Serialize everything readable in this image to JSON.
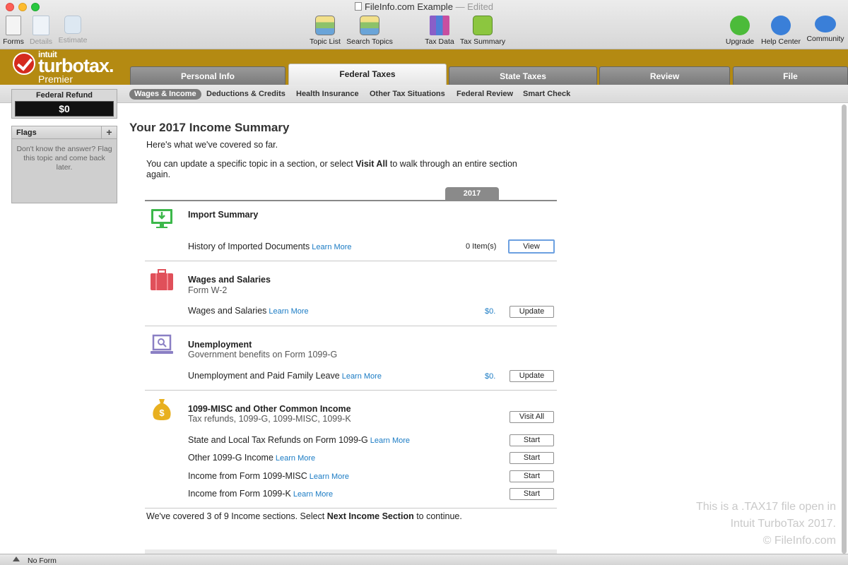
{
  "window": {
    "title": "FileInfo.com Example",
    "edited": "— Edited"
  },
  "toolbar": {
    "left": [
      "Forms",
      "Details",
      "Estimate"
    ],
    "center": [
      "Topic List",
      "Search Topics",
      "Tax Data",
      "Tax Summary"
    ],
    "right": [
      "Upgrade",
      "Help Center",
      "Community"
    ]
  },
  "logo": {
    "intuit": "intuit",
    "brand": "turbotax.",
    "edition": "Premier"
  },
  "tabs": [
    "Personal Info",
    "Federal Taxes",
    "State Taxes",
    "Review",
    "File"
  ],
  "subnav": [
    "Wages & Income",
    "Deductions & Credits",
    "Health Insurance",
    "Other Tax Situations",
    "Federal Review",
    "Smart Check"
  ],
  "refund": {
    "label": "Federal Refund",
    "value": "$0"
  },
  "flags": {
    "title": "Flags",
    "plus": "+",
    "body": "Don't know the answer? Flag this topic and come back later."
  },
  "main": {
    "title": "Your 2017 Income Summary",
    "intro1": "Here's what we've covered so far.",
    "intro2_pre": "You can update a specific topic in a section, or select ",
    "intro2_bold": "Visit All",
    "intro2_post": " to walk through an entire section again.",
    "year": "2017",
    "learn_more": "Learn More",
    "sections": {
      "import": {
        "title": "Import Summary",
        "row": "History of Imported Documents",
        "items": "0 Item(s)",
        "button": "View"
      },
      "wages": {
        "title": "Wages and Salaries",
        "subtitle": "Form W-2",
        "row": "Wages and Salaries",
        "amount": "$0.",
        "button": "Update"
      },
      "unemployment": {
        "title": "Unemployment",
        "subtitle": "Government benefits on Form 1099-G",
        "row": "Unemployment and Paid Family Leave",
        "amount": "$0.",
        "button": "Update"
      },
      "misc": {
        "title": "1099-MISC and Other Common Income",
        "subtitle": "Tax refunds, 1099-G, 1099-MISC, 1099-K",
        "visit_all": "Visit All",
        "rows": [
          {
            "label": "State and Local Tax Refunds on Form 1099-G",
            "button": "Start"
          },
          {
            "label": "Other 1099-G Income",
            "button": "Start"
          },
          {
            "label": "Income from Form 1099-MISC",
            "button": "Start"
          },
          {
            "label": "Income from Form 1099-K",
            "button": "Start"
          }
        ]
      }
    },
    "footer_pre": "We've covered 3 of 9 Income sections. Select ",
    "footer_bold": "Next Income Section",
    "footer_post": " to continue."
  },
  "watermark": [
    "This is a .TAX17 file open in",
    "Intuit TurboTax 2017.",
    "© FileInfo.com"
  ],
  "status": {
    "text": "No Form"
  },
  "colors": {
    "band": "#b48a12",
    "link": "#1a7bc4",
    "import_icon": "#3cb84a",
    "wages_icon": "#e0505a",
    "unemployment_icon": "#8a7fc4",
    "misc_icon": "#e8b020"
  }
}
